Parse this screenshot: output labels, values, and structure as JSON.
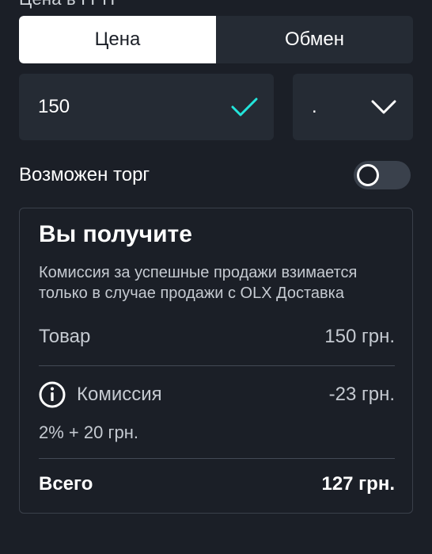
{
  "section_label": "Цена в ГРН",
  "tabs": [
    {
      "label": "Цена",
      "active": true
    },
    {
      "label": "Обмен",
      "active": false
    }
  ],
  "price_field": {
    "value": "150",
    "valid_icon": "check-icon"
  },
  "currency_select": {
    "value": ".",
    "icon": "chevron-down-icon"
  },
  "bargain": {
    "label": "Возможен торг",
    "enabled": false
  },
  "summary": {
    "title": "Вы получите",
    "note": "Комиссия за успешные продажи взимается только в случае продажи с OLX Доставка",
    "item_label": "Товар",
    "item_value": "150 грн.",
    "commission_label": "Комиссия",
    "commission_value": "-23 грн.",
    "commission_formula": "2% + 20 грн.",
    "total_label": "Всего",
    "total_value": "127 грн."
  },
  "colors": {
    "background": "#1b1f27",
    "field": "#252b34",
    "accent": "#23e5db"
  }
}
